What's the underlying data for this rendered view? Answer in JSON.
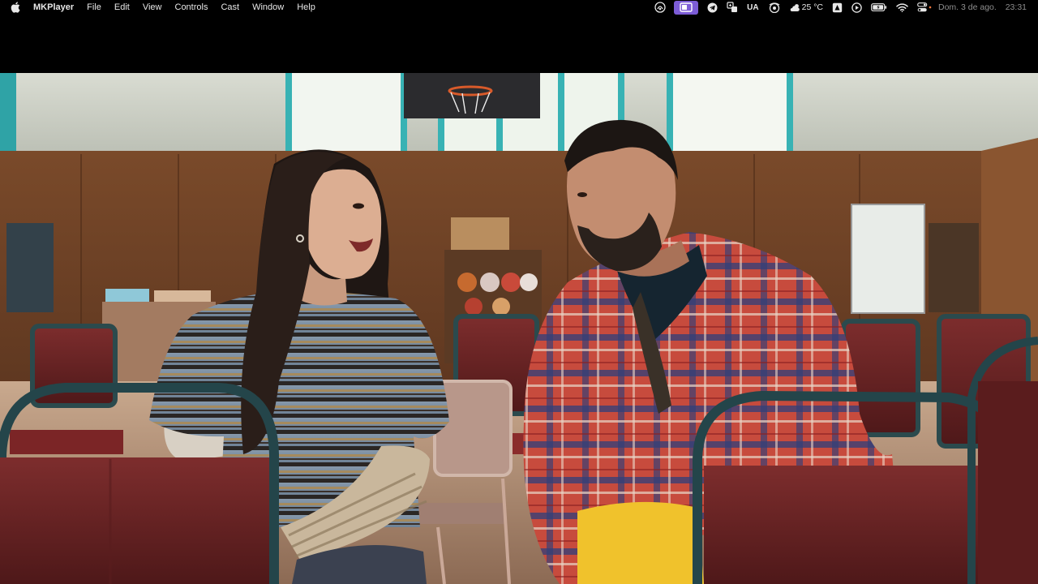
{
  "app": {
    "name": "MKPlayer",
    "menus": [
      "File",
      "Edit",
      "View",
      "Controls",
      "Cast",
      "Window",
      "Help"
    ]
  },
  "status_bar": {
    "icons": [
      "vpn-icon",
      "screen-mirror-icon",
      "telegram-icon",
      "translate-icon",
      "keyboard-layout",
      "cast-stream-icon",
      "weather-icon",
      "arrow-app-icon",
      "play-circle-icon",
      "battery-icon",
      "wifi-icon",
      "control-center-icon"
    ],
    "keyboard_layout": "UA",
    "weather_temp": "25 °C",
    "date": "Dom. 3 de ago.",
    "time": "23:31"
  },
  "colors": {
    "menubar_bg": "#000000",
    "menubar_text": "#e8e8e8",
    "active_tray_bg": "#7c5cd6",
    "datetime_text": "#8e8e8e"
  },
  "video": {
    "state": "playing"
  }
}
